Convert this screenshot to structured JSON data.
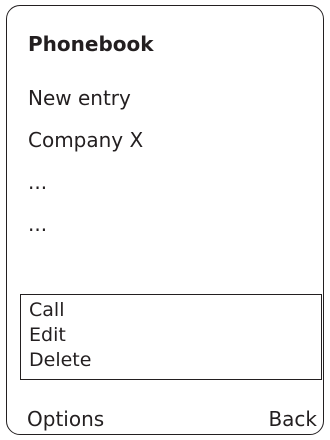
{
  "screen": {
    "title": "Phonebook"
  },
  "entries": [
    {
      "label": "New entry"
    },
    {
      "label": "Company X"
    },
    {
      "label": "..."
    },
    {
      "label": "..."
    }
  ],
  "options_menu": {
    "items": [
      {
        "label": "Call"
      },
      {
        "label": "Edit"
      },
      {
        "label": "Delete"
      }
    ]
  },
  "softkeys": {
    "left": "Options",
    "right": "Back"
  }
}
